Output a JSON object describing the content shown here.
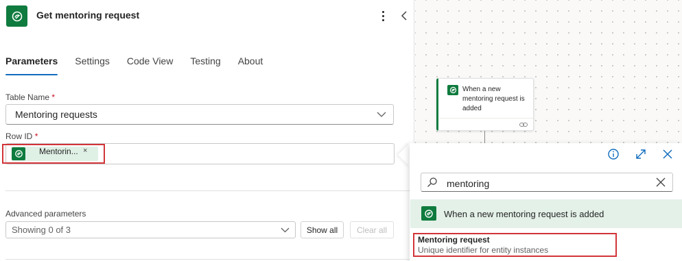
{
  "header": {
    "title": "Get mentoring request"
  },
  "tabs": [
    {
      "label": "Parameters",
      "active": true
    },
    {
      "label": "Settings"
    },
    {
      "label": "Code View"
    },
    {
      "label": "Testing"
    },
    {
      "label": "About"
    }
  ],
  "table_name": {
    "label": "Table Name",
    "required": "*",
    "value": "Mentoring requests"
  },
  "row_id": {
    "label": "Row ID",
    "required": "*",
    "token_label": "Mentorin...",
    "token_remove": "×"
  },
  "advanced": {
    "label": "Advanced parameters",
    "select_value": "Showing 0 of 3",
    "show_all": "Show all",
    "clear_all": "Clear all"
  },
  "canvas": {
    "trigger_card_text": "When a new mentoring request is added"
  },
  "dynamic_content": {
    "search_value": "mentoring",
    "group_title": "When a new mentoring request is added",
    "result_title": "Mentoring request",
    "result_desc": "Unique identifier for entity instances"
  },
  "colors": {
    "brand": "#0f7b3e",
    "accent": "#0f6cbd",
    "highlight": "#d13438"
  },
  "icons": [
    "dataverse-icon",
    "more-vertical-icon",
    "collapse-chevron-icon",
    "chevron-down-icon",
    "info-icon",
    "expand-icon",
    "close-icon",
    "search-icon",
    "link-icon"
  ]
}
